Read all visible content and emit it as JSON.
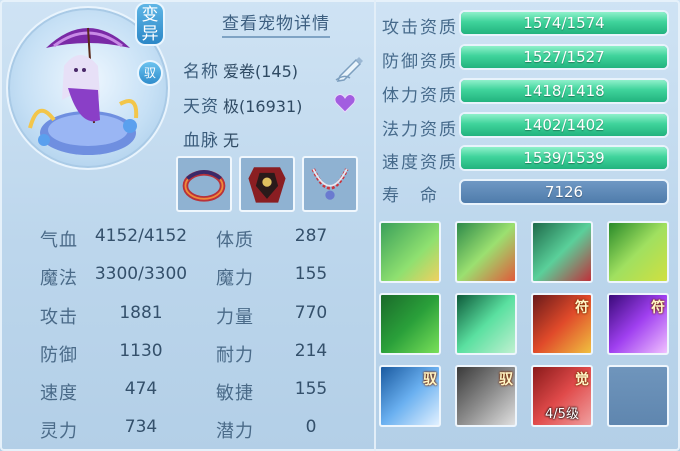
{
  "pet": {
    "variant_badge": "变异",
    "tamed_badge": "驭",
    "details_link": "查看宠物详情",
    "name_label": "名称",
    "name_value": "爱卷(145)",
    "aptitude_label": "天资",
    "aptitude_value": "极(16931)",
    "bloodline_label": "血脉",
    "bloodline_value": "无"
  },
  "equipment": [
    {
      "icon": "ring-equip-icon"
    },
    {
      "icon": "armor-equip-icon"
    },
    {
      "icon": "necklace-equip-icon"
    }
  ],
  "stats": [
    {
      "label": "气血",
      "value": "4152/4152",
      "label2": "体质",
      "value2": "287"
    },
    {
      "label": "魔法",
      "value": "3300/3300",
      "label2": "魔力",
      "value2": "155"
    },
    {
      "label": "攻击",
      "value": "1881",
      "label2": "力量",
      "value2": "770"
    },
    {
      "label": "防御",
      "value": "1130",
      "label2": "耐力",
      "value2": "214"
    },
    {
      "label": "速度",
      "value": "474",
      "label2": "敏捷",
      "value2": "155"
    },
    {
      "label": "灵力",
      "value": "734",
      "label2": "潜力",
      "value2": "0"
    }
  ],
  "aptitudes": [
    {
      "label": "攻击资质",
      "value": "1574/1574",
      "fill": 1.0
    },
    {
      "label": "防御资质",
      "value": "1527/1527",
      "fill": 1.0
    },
    {
      "label": "体力资质",
      "value": "1418/1418",
      "fill": 1.0
    },
    {
      "label": "法力资质",
      "value": "1402/1402",
      "fill": 1.0
    },
    {
      "label": "速度资质",
      "value": "1539/1539",
      "fill": 1.0
    }
  ],
  "lifespan": {
    "label": "寿　命",
    "value": "7126"
  },
  "skills": [
    {
      "icon": "sword-skill-icon",
      "tag": "",
      "level": ""
    },
    {
      "icon": "fire-figure-skill-icon",
      "tag": "",
      "level": ""
    },
    {
      "icon": "blood-drop-skill-icon",
      "tag": "",
      "level": ""
    },
    {
      "icon": "shield-face-skill-icon",
      "tag": "",
      "level": ""
    },
    {
      "icon": "green-giant-skill-icon",
      "tag": "",
      "level": ""
    },
    {
      "icon": "green-burst-skill-icon",
      "tag": "",
      "level": ""
    },
    {
      "icon": "red-talisman-skill-icon",
      "tag": "符",
      "level": ""
    },
    {
      "icon": "purple-burst-skill-icon",
      "tag": "符",
      "level": ""
    },
    {
      "icon": "blue-shield-skill-icon",
      "tag": "驭",
      "level": ""
    },
    {
      "icon": "claw-skill-icon",
      "tag": "驭",
      "level": ""
    },
    {
      "icon": "awaken-skill-icon",
      "tag": "觉",
      "level": "4/5级"
    },
    {
      "icon": "empty-slot",
      "tag": "",
      "level": ""
    }
  ],
  "colors": {
    "background": "#c3dbef",
    "bar_fill": "#3fd39b",
    "bar_track": "#5b88b5",
    "text_primary": "#3b5c7b"
  }
}
